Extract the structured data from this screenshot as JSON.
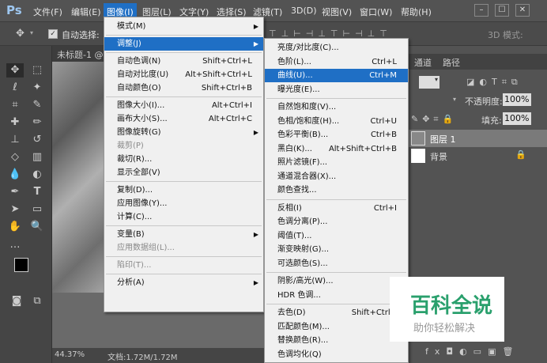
{
  "app": {
    "logo": "Ps"
  },
  "menubar": {
    "items": [
      "文件(F)",
      "编辑(E)",
      "图像(I)",
      "图层(L)",
      "文字(Y)",
      "选择(S)",
      "滤镜(T)",
      "3D(D)",
      "视图(V)",
      "窗口(W)",
      "帮助(H)"
    ],
    "window_controls": [
      "–",
      "☐",
      "✕"
    ]
  },
  "options_bar": {
    "auto_select": "自动选择:",
    "mode_3d": "3D 模式:"
  },
  "document": {
    "tab_title": "未标题-1 @",
    "zoom": "44.37%",
    "doc_size": "文档:1.72M/1.72M"
  },
  "panels": {
    "tabs": [
      "通道",
      "路径"
    ],
    "opacity_label": "不透明度:",
    "opacity_value": "100%",
    "fill_label": "填充:",
    "fill_value": "100%",
    "layers": [
      "图层 1",
      "背景"
    ]
  },
  "image_menu": [
    {
      "label": "模式(M)",
      "shortcut": "",
      "submenu": true,
      "disabled": false
    },
    {
      "sep": true
    },
    {
      "label": "调整(J)",
      "shortcut": "",
      "submenu": true,
      "disabled": false,
      "highlight": true
    },
    {
      "sep": true
    },
    {
      "label": "自动色调(N)",
      "shortcut": "Shift+Ctrl+L"
    },
    {
      "label": "自动对比度(U)",
      "shortcut": "Alt+Shift+Ctrl+L"
    },
    {
      "label": "自动颜色(O)",
      "shortcut": "Shift+Ctrl+B"
    },
    {
      "sep": true
    },
    {
      "label": "图像大小(I)...",
      "shortcut": "Alt+Ctrl+I"
    },
    {
      "label": "画布大小(S)...",
      "shortcut": "Alt+Ctrl+C"
    },
    {
      "label": "图像旋转(G)",
      "shortcut": "",
      "submenu": true
    },
    {
      "label": "裁剪(P)",
      "shortcut": "",
      "disabled": true
    },
    {
      "label": "裁切(R)...",
      "shortcut": ""
    },
    {
      "label": "显示全部(V)",
      "shortcut": ""
    },
    {
      "sep": true
    },
    {
      "label": "复制(D)...",
      "shortcut": ""
    },
    {
      "label": "应用图像(Y)...",
      "shortcut": ""
    },
    {
      "label": "计算(C)...",
      "shortcut": ""
    },
    {
      "sep": true
    },
    {
      "label": "变量(B)",
      "shortcut": "",
      "submenu": true
    },
    {
      "label": "应用数据组(L)...",
      "shortcut": "",
      "disabled": true
    },
    {
      "sep": true
    },
    {
      "label": "陷印(T)...",
      "shortcut": "",
      "disabled": true
    },
    {
      "sep": true
    },
    {
      "label": "分析(A)",
      "shortcut": "",
      "submenu": true
    }
  ],
  "adjust_menu": [
    {
      "label": "亮度/对比度(C)...",
      "shortcut": ""
    },
    {
      "label": "色阶(L)...",
      "shortcut": "Ctrl+L"
    },
    {
      "label": "曲线(U)...",
      "shortcut": "Ctrl+M",
      "highlight": true
    },
    {
      "label": "曝光度(E)...",
      "shortcut": ""
    },
    {
      "sep": true
    },
    {
      "label": "自然饱和度(V)...",
      "shortcut": ""
    },
    {
      "label": "色相/饱和度(H)...",
      "shortcut": "Ctrl+U"
    },
    {
      "label": "色彩平衡(B)...",
      "shortcut": "Ctrl+B"
    },
    {
      "label": "黑白(K)...",
      "shortcut": "Alt+Shift+Ctrl+B"
    },
    {
      "label": "照片滤镜(F)...",
      "shortcut": ""
    },
    {
      "label": "通道混合器(X)...",
      "shortcut": ""
    },
    {
      "label": "颜色查找...",
      "shortcut": ""
    },
    {
      "sep": true
    },
    {
      "label": "反相(I)",
      "shortcut": "Ctrl+I"
    },
    {
      "label": "色调分离(P)...",
      "shortcut": ""
    },
    {
      "label": "阈值(T)...",
      "shortcut": ""
    },
    {
      "label": "渐变映射(G)...",
      "shortcut": ""
    },
    {
      "label": "可选颜色(S)...",
      "shortcut": ""
    },
    {
      "sep": true
    },
    {
      "label": "阴影/高光(W)...",
      "shortcut": ""
    },
    {
      "label": "HDR 色调...",
      "shortcut": ""
    },
    {
      "sep": true
    },
    {
      "label": "去色(D)",
      "shortcut": "Shift+Ctrl+"
    },
    {
      "label": "匹配颜色(M)...",
      "shortcut": ""
    },
    {
      "label": "替换颜色(R)...",
      "shortcut": ""
    },
    {
      "label": "色调均化(Q)",
      "shortcut": ""
    }
  ],
  "watermark": {
    "title": "百科全说",
    "subtitle": "助你轻松解决"
  }
}
